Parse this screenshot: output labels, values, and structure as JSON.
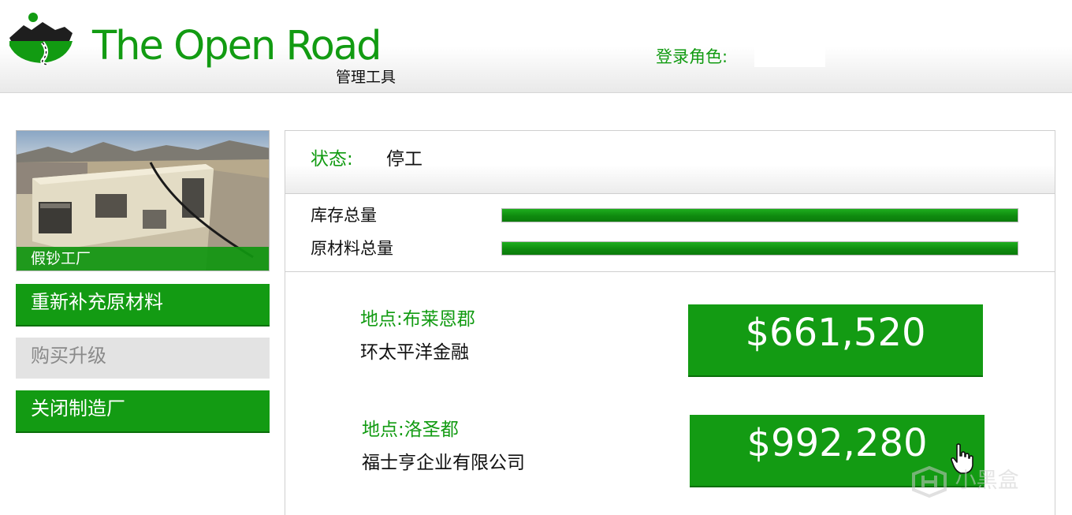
{
  "header": {
    "brand_title": "The Open Road",
    "brand_subtitle": "管理工具",
    "login_label": "登录角色:",
    "login_value": ""
  },
  "sidebar": {
    "business_name": "假钞工厂",
    "buttons": [
      {
        "label": "重新补充原材料",
        "state": "enabled"
      },
      {
        "label": "购买升级",
        "state": "disabled"
      },
      {
        "label": "关闭制造厂",
        "state": "enabled"
      }
    ]
  },
  "main": {
    "status_label": "状态:",
    "status_value": "停工",
    "gauges": [
      {
        "label": "库存总量",
        "fill_percent": 100
      },
      {
        "label": "原材料总量",
        "fill_percent": 100
      }
    ],
    "sales": [
      {
        "location": "地点:布莱恩郡",
        "buyer": "环太平洋金融",
        "price": "$661,520"
      },
      {
        "location": "地点:洛圣都",
        "buyer": "福士亨企业有限公司",
        "price": "$992,280"
      }
    ]
  },
  "watermark": {
    "text": "小黑盒"
  },
  "colors": {
    "brand_green": "#129b12",
    "button_green": "#139b13",
    "disabled_gray": "#e3e3e3"
  },
  "icons": {
    "logo": "road-mountain-logo-icon",
    "cursor": "hand-pointer-icon",
    "watermark": "heybox-logo-icon"
  }
}
